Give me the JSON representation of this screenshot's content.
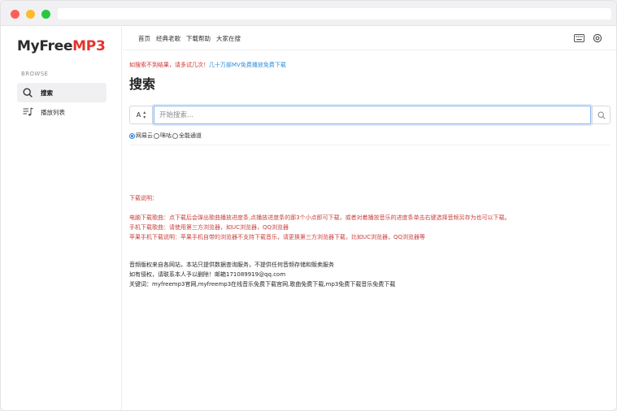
{
  "brand": {
    "name_part1": "MyFree",
    "name_part2": "MP3",
    "accent": "#e5332b"
  },
  "sidebar": {
    "section_label": "BROWSE",
    "items": [
      {
        "label": "搜索",
        "icon": "search-icon",
        "active": true
      },
      {
        "label": "播放列表",
        "icon": "playlist-icon",
        "active": false
      }
    ]
  },
  "topnav": {
    "links": [
      "首页",
      "经典老歌",
      "下载帮助",
      "大家在搜"
    ],
    "icons": [
      "keyboard-icon",
      "settings-icon"
    ]
  },
  "main": {
    "notice_text": "如搜索不到结果，请多试几次！",
    "notice_link": "几十万部MV免费播放免费下载",
    "title": "搜索",
    "search": {
      "selector_value": "A",
      "placeholder": "开始搜索...",
      "value": ""
    },
    "sources": [
      {
        "label": "网易云",
        "checked": true
      },
      {
        "label": "咪咕",
        "checked": false
      },
      {
        "label": "全能通道",
        "checked": false
      }
    ],
    "help": {
      "heading": "下载说明：",
      "lines": [
        "电脑下载歌曲：点下载后会弹出歌曲播放进度条,点播放进度条的那3个小点即可下载，或者对着播放音乐的进度条单击右键选择音频另存为也可以下载。",
        "手机下载歌曲：请使用第三方浏览器，如UC浏览器，QQ浏览器",
        "苹果手机下载说明：苹果手机自带的浏览器不支持下载音乐，请更换第三方浏览器下载，比如UC浏览器，QQ浏览器等"
      ]
    },
    "footer": {
      "lines": [
        "音频版权来自各网站，本站只提供数据查询服务，不提供任何音频存储和贩卖服务",
        "如有侵权，请联系本人予以删除！邮箱171089919@qq.com",
        "关键词：myfreemp3官网,myfreemp3在线音乐免费下载官网,歌曲免费下载,mp3免费下载音乐免费下载"
      ]
    }
  },
  "colors": {
    "notice_red": "#d0332f",
    "link_blue": "#2d8fd8",
    "focus_blue": "#8ab9ee"
  }
}
